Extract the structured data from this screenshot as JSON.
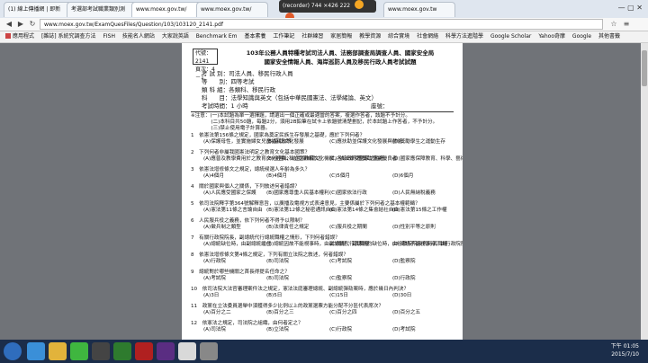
{
  "browser": {
    "tabs": [
      {
        "label": "(1) 線上傳播網 | 即新",
        "active": false
      },
      {
        "label": "考選部考試職業類別測",
        "active": false
      },
      {
        "label": "www.moex.gov.tw/",
        "active": true
      },
      {
        "label": "www.moex.gov.tw/",
        "active": false
      },
      {
        "label": "www.moex.gov.tw",
        "active": false
      }
    ],
    "url": "www.moex.gov.tw/ExamQuesFiles/Question/103/103120_2141.pdf",
    "bookmarks": [
      "應用程式",
      "[雜誌] 系統究調查方法",
      "FISH",
      "技能名人網站",
      "大家說英語",
      "Benchmark Em",
      "基本素養",
      "工作筆記",
      "社群練習",
      "家居簡報",
      "教學資源",
      "綜合實境",
      "社會網絡",
      "科學方法進階學",
      "Google Scholar",
      "Yahoo奇摩",
      "Google",
      "其他書籤"
    ],
    "recorder": {
      "label": "(recorder) 744 ×426 222",
      "fn": "Free"
    }
  },
  "doc": {
    "code": {
      "line1": "代號：2141",
      "line2": "頁次：4－1"
    },
    "title_lines": [
      "103年公務人員特種考試司法人員、法務部調查局調查人員、國家安全局",
      "國家安全情報人員、海岸巡防人員及移民行政人員考試試題"
    ],
    "meta": [
      "考 試 別：司法人員、移民行政人員",
      "等　　別：四等考試",
      "類 科 組：各類科、移民行政",
      "科　　目：法學知識與英文（包括中華民國憲法、法學緒論、英文）",
      "考試時間：1 小時"
    ],
    "seat_label": "座號：",
    "notes": [
      "※注意：(一)本試題為單一選擇題，請選出一個正確或最適當的答案，複選作答者，該題不予計分。",
      "　　　　(二)本科目共50題，每題2分，須用2B鉛筆在試卡上依題號清楚劃記，於本試題上作答者，不予計分。",
      "　　　　(三)禁止使用電子計算器。"
    ],
    "questions": [
      {
        "q": "1　依憲法第156條之規定，國家為奠定民族生存發展之基礎，應於下列何者？",
        "opts": [
          "(A)保護母性，並實施婦女兒童福利政策",
          "(B)協助文化發展",
          "(C)應扶助並保護文化發展與藝術",
          "(D)獎勵學生之運動生存"
        ]
      },
      {
        "q": "2　下列何者非屬我國憲法明定之教育文化基本國策？",
        "opts": [
          "(A)應普及教學費用於之教育文化經費，依國庫補助之",
          "(B)全國公私立之教育文化機關，依法律受國家之監督",
          "(C)各級政府應獎助學業優良者",
          "(D)國家應保障教育、科學、藝術工作者之生活"
        ]
      },
      {
        "q": "3　依憲法增修條文之規定，總統候選人年齡為多久？",
        "opts": [
          "(A)4個月",
          "(B)4個月",
          "(C)5個月",
          "(D)6個月"
        ]
      },
      {
        "q": "4　關於國家與個人之關係，下列敘述何者錯誤？",
        "opts": [
          "(A)人民應受國家之保護",
          "(B)國家應尊重人民基本權利",
          "(C)國家依法行政",
          "(D)人民無納稅義務"
        ]
      },
      {
        "q": "5　依司法院釋字第364號解釋意旨，以廣播及電視方式表達意見，主要係屬於下列何者之基本權範疇？",
        "opts": [
          "(A)憲法第11條之言論自由",
          "(B)憲法第12條之秘密通訊自由",
          "(C)憲法第14條之集會結社自由",
          "(D)憲法第15條之工作權"
        ]
      },
      {
        "q": "6　人民服兵役之義務，依下列何者不得予以限制？",
        "opts": [
          "(A)徵兵制之類型",
          "(B)法律責任之規定",
          "(C)服兵役之期間",
          "(D)性別平等之原則"
        ]
      },
      {
        "q": "7　有關行政院院長，副總統代行總統職權之情形，下列何者錯誤？",
        "opts": [
          "(A)總統缺位時，由副總統繼任",
          "(B)總統因故不能視事時，由副總統代行其職權",
          "(C)總統、副總統均缺位時，由行政院院長代行其職權",
          "(D)總統不能視事時，由行政院院長代行其職權"
        ]
      },
      {
        "q": "8　依憲法增修條文第4條之規定，下列有關立法院之敘述，何者錯誤？",
        "opts": [
          "(A)行政院",
          "(B)司法院",
          "(C)考試院",
          "(D)監察院"
        ]
      },
      {
        "q": "9　總統對於哪些機關之首長得提名任命之？",
        "opts": [
          "(A)考試院",
          "(B)司法院",
          "(C)監察院",
          "(D)行政院"
        ]
      },
      {
        "q": "10　依司法院大法官審理案件法之規定，憲法法庭審理總統、副總統彈劾案時，應於幾日內判決？",
        "opts": [
          "(A)3日",
          "(B)5日",
          "(C)15日",
          "(D)30日"
        ]
      },
      {
        "q": "11　政黨在立法委員選舉中須獲得多少比例以上的政黨選票方能分配不分區代表席次？",
        "opts": [
          "(A)百分之二",
          "(B)百分之三",
          "(C)百分之四",
          "(D)百分之五"
        ]
      },
      {
        "q": "12　依憲法之規定，司法院之組織，由何者定之？",
        "opts": [
          "(A)司法院",
          "(B)立法院",
          "(C)行政院",
          "(D)考試院"
        ]
      }
    ]
  },
  "taskbar": {
    "time": "下午 01:05",
    "date": "2015/7/10"
  }
}
